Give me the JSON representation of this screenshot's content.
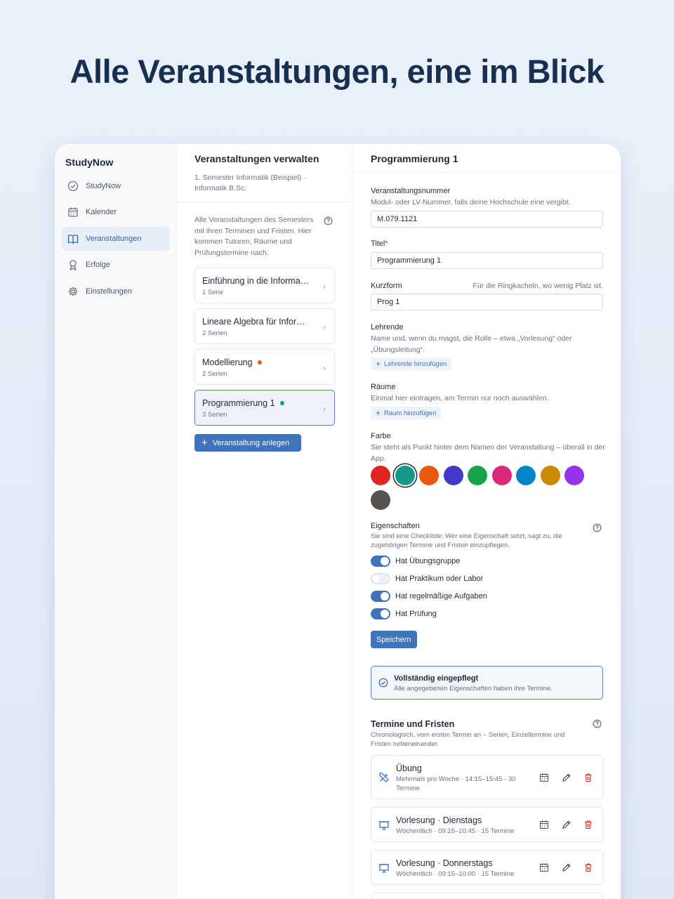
{
  "headline": "Alle Veranstaltungen, eine im Blick",
  "sidebar": {
    "app_name": "StudyNow",
    "items": [
      {
        "label": "StudyNow",
        "icon": "check-circle-icon"
      },
      {
        "label": "Kalender",
        "icon": "calendar-icon"
      },
      {
        "label": "Veranstaltungen",
        "icon": "book-icon",
        "active": true
      },
      {
        "label": "Erfolge",
        "icon": "award-icon"
      },
      {
        "label": "Einstellungen",
        "icon": "gear-icon"
      }
    ]
  },
  "middle": {
    "title": "Veranstaltungen verwalten",
    "subtitle": "1. Semester Informatik (Beispiel) · Informatik B.Sc.",
    "description": "Alle Veranstaltungen des Semesters mit ihren Terminen und Fristen. Hier kommen Tutoren, Räume und Prüfungstermine nach.",
    "courses": [
      {
        "name": "Einführung in die Informa…",
        "count": "1 Serie",
        "dot": null
      },
      {
        "name": "Lineare Algebra für Infor…",
        "count": "2 Serien",
        "dot": null
      },
      {
        "name": "Modellierung",
        "count": "2 Serien",
        "dot": "#e8590c"
      },
      {
        "name": "Programmierung 1",
        "count": "3 Serien",
        "dot": "#12998a",
        "selected": true
      }
    ],
    "add_button": "Veranstaltung anlegen"
  },
  "detail": {
    "title": "Programmierung 1",
    "number": {
      "label": "Veranstaltungsnummer",
      "hint": "Modul- oder LV-Nummer, falls deine Hochschule eine vergibt.",
      "value": "M.079.1121"
    },
    "titel": {
      "label": "Titel",
      "required": "*",
      "value": "Programmierung 1"
    },
    "kurzform": {
      "label": "Kurzform",
      "hint": "Für die Ringkacheln, wo wenig Platz ist.",
      "value": "Prog 1"
    },
    "lehrende": {
      "label": "Lehrende",
      "hint": "Name und, wenn du magst, die Rolle – etwa „Vorlesung“ oder „Übungsleitung“.",
      "button": "Lehrende hinzufügen"
    },
    "raeume": {
      "label": "Räume",
      "hint": "Einmal hier eintragen, am Termin nur noch auswählen.",
      "button": "Raum hinzufügen"
    },
    "farbe": {
      "label": "Farbe",
      "hint": "Sie steht als Punkt hinter dem Namen der Veranstaltung – überall in der App.",
      "colors": [
        "#e02424",
        "#12998a",
        "#ea580c",
        "#4338ca",
        "#16a34a",
        "#db2777",
        "#0284c7",
        "#ca8a04",
        "#9333ea",
        "#57534e"
      ],
      "selected_index": 1
    },
    "eigenschaften": {
      "label": "Eigenschaften",
      "hint": "Sie sind eine Checkliste: Wer eine Eigenschaft setzt, sagt zu, die zugehörigen Termine und Fristen einzupflegen.",
      "toggles": [
        {
          "label": "Hat Übungsgruppe",
          "on": true
        },
        {
          "label": "Hat Praktikum oder Labor",
          "on": false
        },
        {
          "label": "Hat regelmäßige Aufgaben",
          "on": true
        },
        {
          "label": "Hat Prüfung",
          "on": true
        }
      ]
    },
    "save_button": "Speichern",
    "status": {
      "title": "Vollständig eingepflegt",
      "subtitle": "Alle angegebenen Eigenschaften haben ihre Termine."
    },
    "termine": {
      "title": "Termine und Fristen",
      "hint": "Chronologisch, vom ersten Termin an – Serien, Einzeltermine und Fristen nebeneinander.",
      "items": [
        {
          "title": "Übung",
          "sub": "Mehrmals pro Woche · 14:15–15:45 · 30 Termine",
          "icon": "tools-icon"
        },
        {
          "title": "Vorlesung · Dienstags",
          "sub": "Wöchentlich · 09:15–10:45 · 15 Termine",
          "icon": "presentation-icon"
        },
        {
          "title": "Vorlesung · Donnerstags",
          "sub": "Wöchentlich · 09:15–10:00 · 15 Termine",
          "icon": "presentation-icon"
        }
      ]
    }
  }
}
